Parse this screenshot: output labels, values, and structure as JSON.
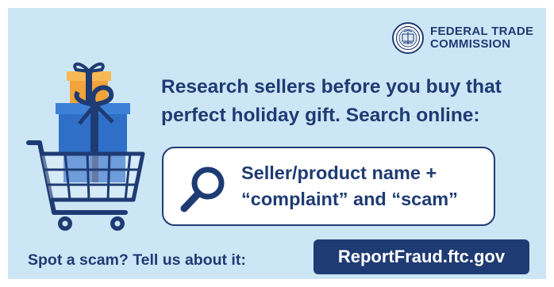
{
  "logo": {
    "line1": "FEDERAL TRADE",
    "line2": "COMMISSION",
    "icon": "ftc-seal-icon"
  },
  "headline": {
    "line1": "Research sellers before you buy that",
    "line2": "perfect holiday gift. Search online:"
  },
  "search": {
    "line1": "Seller/product name +",
    "line2": "“complaint” and “scam”",
    "icon": "magnifying-glass-icon"
  },
  "footer": {
    "prompt": "Spot a scam? Tell us about it:",
    "link": "ReportFraud.ftc.gov"
  },
  "illustration": {
    "icon": "shopping-cart-with-gifts-icon"
  },
  "colors": {
    "background": "#cde6f6",
    "navy": "#1f3b73",
    "gift_blue": "#2f6fc8",
    "gift_orange": "#f2a33a"
  }
}
